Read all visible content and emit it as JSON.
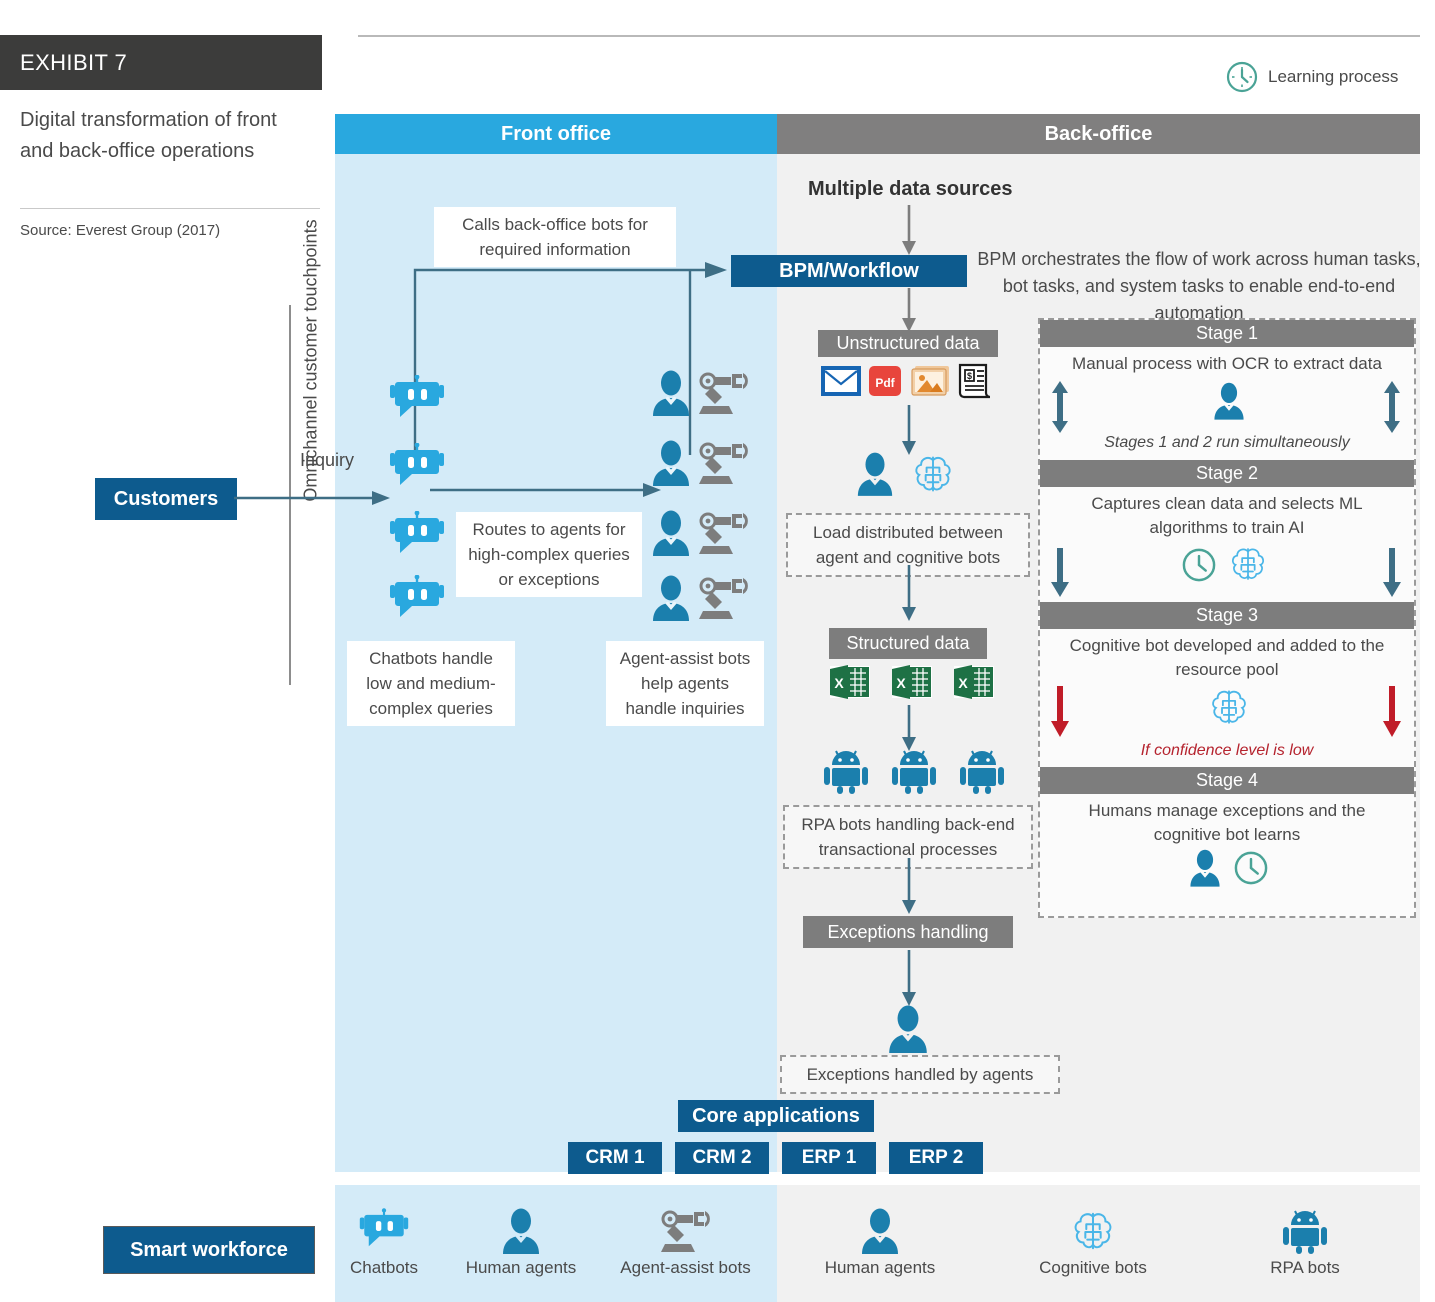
{
  "exhibit": {
    "number": "EXHIBIT 7",
    "title": "Digital transformation of front and back-office operations",
    "source": "Source: Everest Group (2017)"
  },
  "legend_top": {
    "learning_process": "Learning process",
    "icon": "clock-icon"
  },
  "bands": {
    "front": "Front office",
    "back": "Back-office"
  },
  "axis": {
    "label": "Omnichannel customer touchpoints"
  },
  "front_office": {
    "customers": "Customers",
    "inquiry": "Inquiry",
    "callout_calls_back": "Calls back-office bots for required information",
    "callout_routes": "Routes to agents for high-complex queries or exceptions",
    "caption_chatbots": "Chatbots handle low and medium-complex queries",
    "caption_agent_assist": "Agent-assist bots help agents handle inquiries"
  },
  "back_office": {
    "multiple_data_sources": "Multiple data sources",
    "bpm_workflow": "BPM/Workflow",
    "bpm_description": "BPM orchestrates the flow of work across human tasks, bot tasks, and system tasks to enable end-to-end automation",
    "unstructured_data": "Unstructured data",
    "unstructured_icons": [
      "email-icon",
      "pdf-icon",
      "image-icon",
      "invoice-icon"
    ],
    "load_note": "Load distributed between agent and cognitive bots",
    "structured_data": "Structured data",
    "structured_icons": [
      "excel-icon",
      "excel-icon",
      "excel-icon"
    ],
    "rpa_note": "RPA bots handling back-end transactional processes",
    "exceptions_handling": "Exceptions handling",
    "exceptions_note": "Exceptions handled by agents"
  },
  "stages": [
    {
      "title": "Stage 1",
      "body": "Manual process with OCR to extract data",
      "icons": [
        "person-icon"
      ],
      "note": "Stages 1 and 2 run simultaneously",
      "note_color": "#4a4a4a"
    },
    {
      "title": "Stage 2",
      "body": "Captures clean data and selects ML algorithms to train AI",
      "icons": [
        "clock-icon",
        "brain-icon"
      ],
      "note": "",
      "note_color": "#4a4a4a"
    },
    {
      "title": "Stage 3",
      "body": "Cognitive bot developed and added to the resource pool",
      "icons": [
        "brain-icon"
      ],
      "note": "If confidence level is low",
      "note_color": "#b5232e"
    },
    {
      "title": "Stage 4",
      "body": "Humans manage exceptions and the cognitive bot learns",
      "icons": [
        "person-icon",
        "clock-icon"
      ],
      "note": "",
      "note_color": "#4a4a4a"
    }
  ],
  "core_applications": {
    "title": "Core applications",
    "apps": [
      "CRM 1",
      "CRM 2",
      "ERP 1",
      "ERP 2"
    ]
  },
  "smart_workforce": {
    "label": "Smart workforce",
    "items": [
      {
        "label": "Chatbots",
        "icon": "chatbot-icon"
      },
      {
        "label": "Human agents",
        "icon": "person-icon"
      },
      {
        "label": "Agent-assist bots",
        "icon": "robot-arm-icon"
      },
      {
        "label": "Human agents",
        "icon": "person-icon"
      },
      {
        "label": "Cognitive bots",
        "icon": "brain-icon"
      },
      {
        "label": "RPA bots",
        "icon": "android-icon"
      }
    ]
  },
  "colors": {
    "front_band": "#29a8df",
    "back_band": "#807f7f",
    "front_panel": "#d4ebf8",
    "back_panel": "#f1f1f1",
    "navy": "#0d5b8e",
    "gray_box": "#7d7d7d",
    "teal": "#4aa396",
    "red": "#b5232e",
    "exhibit_bar": "#3c3c3b"
  }
}
